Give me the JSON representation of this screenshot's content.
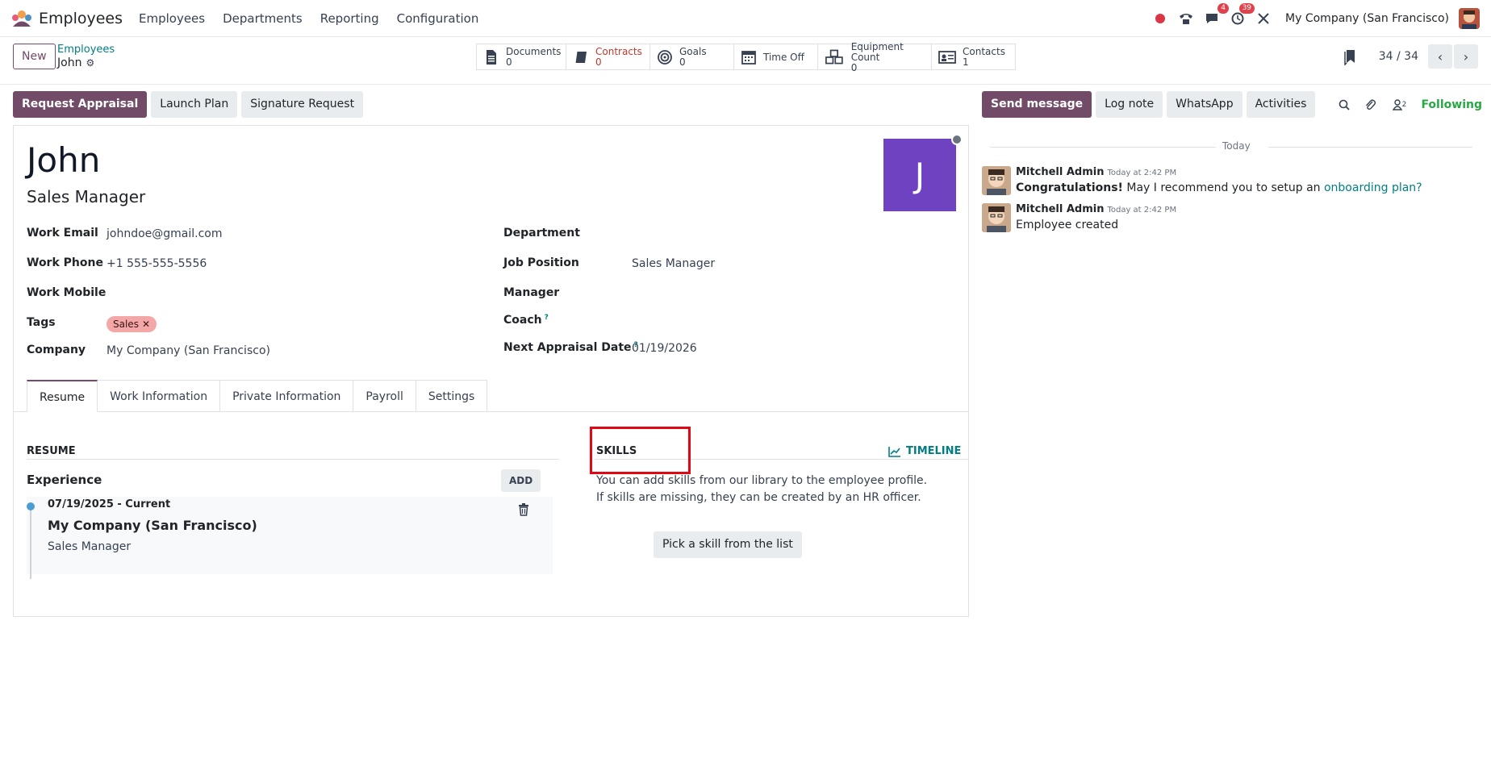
{
  "navbar": {
    "app_title": "Employees",
    "menu": [
      "Employees",
      "Departments",
      "Reporting",
      "Configuration"
    ],
    "messages_badge": "4",
    "activities_badge": "39",
    "company": "My Company (San Francisco)"
  },
  "control_panel": {
    "new_label": "New",
    "breadcrumb_parent": "Employees",
    "breadcrumb_current": "John",
    "smart_buttons": [
      {
        "label": "Documents",
        "value": "0",
        "icon": "documents-icon"
      },
      {
        "label": "Contracts",
        "value": "0",
        "icon": "contracts-icon",
        "color": "#c0392b"
      },
      {
        "label": "Goals",
        "value": "0",
        "icon": "goals-icon"
      },
      {
        "label": "Time Off",
        "icon": "time-off-icon"
      },
      {
        "label": "Equipment Count",
        "value": "0",
        "icon": "equipment-icon"
      },
      {
        "label": "Contacts",
        "value": "1",
        "icon": "contacts-icon"
      }
    ],
    "pager": "34 / 34"
  },
  "statusbar": {
    "request_appraisal": "Request Appraisal",
    "launch_plan": "Launch Plan",
    "signature_request": "Signature Request"
  },
  "employee": {
    "name": "John",
    "job_title": "Sales Manager",
    "avatar_letter": "J",
    "avatar_color": "#6f42c1"
  },
  "fields_left": {
    "work_email_label": "Work Email",
    "work_email": "johndoe@gmail.com",
    "work_phone_label": "Work Phone",
    "work_phone": "+1 555-555-5556",
    "work_mobile_label": "Work Mobile",
    "tags_label": "Tags",
    "tag": "Sales",
    "company_label": "Company",
    "company": "My Company (San Francisco)"
  },
  "fields_right": {
    "department_label": "Department",
    "job_position_label": "Job Position",
    "job_position": "Sales Manager",
    "manager_label": "Manager",
    "coach_label": "Coach",
    "next_appraisal_label": "Next Appraisal Date",
    "next_appraisal": "01/19/2026"
  },
  "tabs": [
    "Resume",
    "Work Information",
    "Private Information",
    "Payroll",
    "Settings"
  ],
  "resume": {
    "title": "RESUME",
    "experience_label": "Experience",
    "add_label": "ADD",
    "entry_dates": "07/19/2025 - Current",
    "entry_company": "My Company (San Francisco)",
    "entry_role": "Sales Manager"
  },
  "skills": {
    "title": "SKILLS",
    "timeline_label": "TIMELINE",
    "line1": "You can add skills from our library to the employee profile.",
    "line2": "If skills are missing, they can be created by an HR officer.",
    "pick_label": "Pick a skill from the list"
  },
  "chatter": {
    "send_message": "Send message",
    "log_note": "Log note",
    "whatsapp": "WhatsApp",
    "activities": "Activities",
    "followers_count": "2",
    "following": "Following",
    "today": "Today",
    "messages": [
      {
        "author": "Mitchell Admin",
        "time": "Today at 2:42 PM",
        "bold": "Congratulations!",
        "text": " May I recommend you to setup an ",
        "link": "onboarding plan?"
      },
      {
        "author": "Mitchell Admin",
        "time": "Today at 2:42 PM",
        "text": "Employee created"
      }
    ]
  },
  "colors": {
    "primary": "#714b67",
    "link": "#017e84",
    "highlight": "#e30613"
  }
}
